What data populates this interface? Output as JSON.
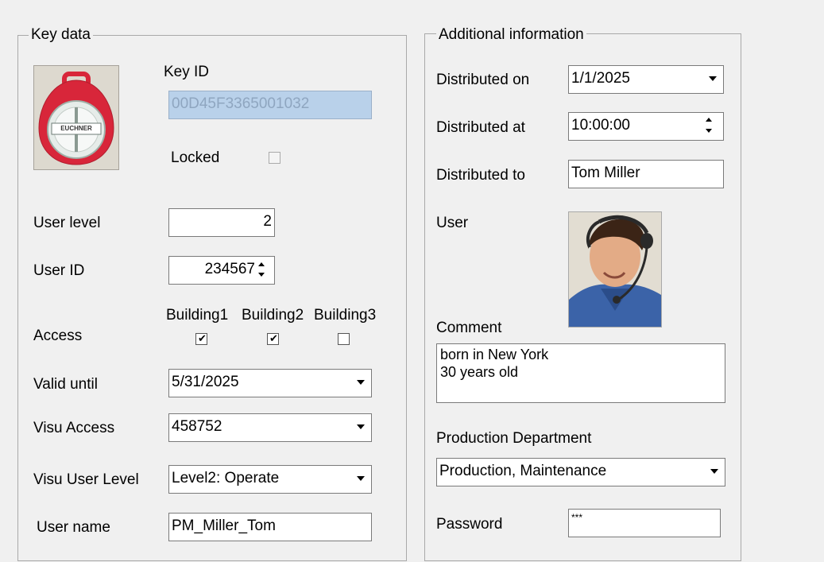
{
  "key_data": {
    "group_label": "Key data",
    "key_id_label": "Key ID",
    "key_id_value": "00D45F3365001032",
    "locked_label": "Locked",
    "locked_checked": false,
    "key_logo_text": "EUCHNER",
    "user_level_label": "User level",
    "user_level_value": "2",
    "user_id_label": "User ID",
    "user_id_value": "234567",
    "access_label": "Access",
    "buildings": [
      {
        "label": "Building1",
        "checked": true
      },
      {
        "label": "Building2",
        "checked": true
      },
      {
        "label": "Building3",
        "checked": false
      }
    ],
    "valid_until_label": "Valid until",
    "valid_until_value": "5/31/2025",
    "visu_access_label": "Visu Access",
    "visu_access_value": "458752",
    "visu_user_level_label": "Visu User Level",
    "visu_user_level_value": "Level2: Operate",
    "user_name_label": "User name",
    "user_name_value": "PM_Miller_Tom"
  },
  "additional_info": {
    "group_label": "Additional information",
    "distributed_on_label": "Distributed on",
    "distributed_on_value": "1/1/2025",
    "distributed_at_label": "Distributed at",
    "distributed_at_value": "10:00:00",
    "distributed_to_label": "Distributed to",
    "distributed_to_value": "Tom Miller",
    "user_label": "User",
    "comment_label": "Comment",
    "comment_value": "born in New York\n30 years old",
    "department_label": "Production Department",
    "department_value": "Production, Maintenance",
    "password_label": "Password",
    "password_value": "***"
  },
  "colors": {
    "background": "#f0f0f0",
    "disabled_field": "#b9d1ea",
    "key_red": "#d8263a"
  }
}
